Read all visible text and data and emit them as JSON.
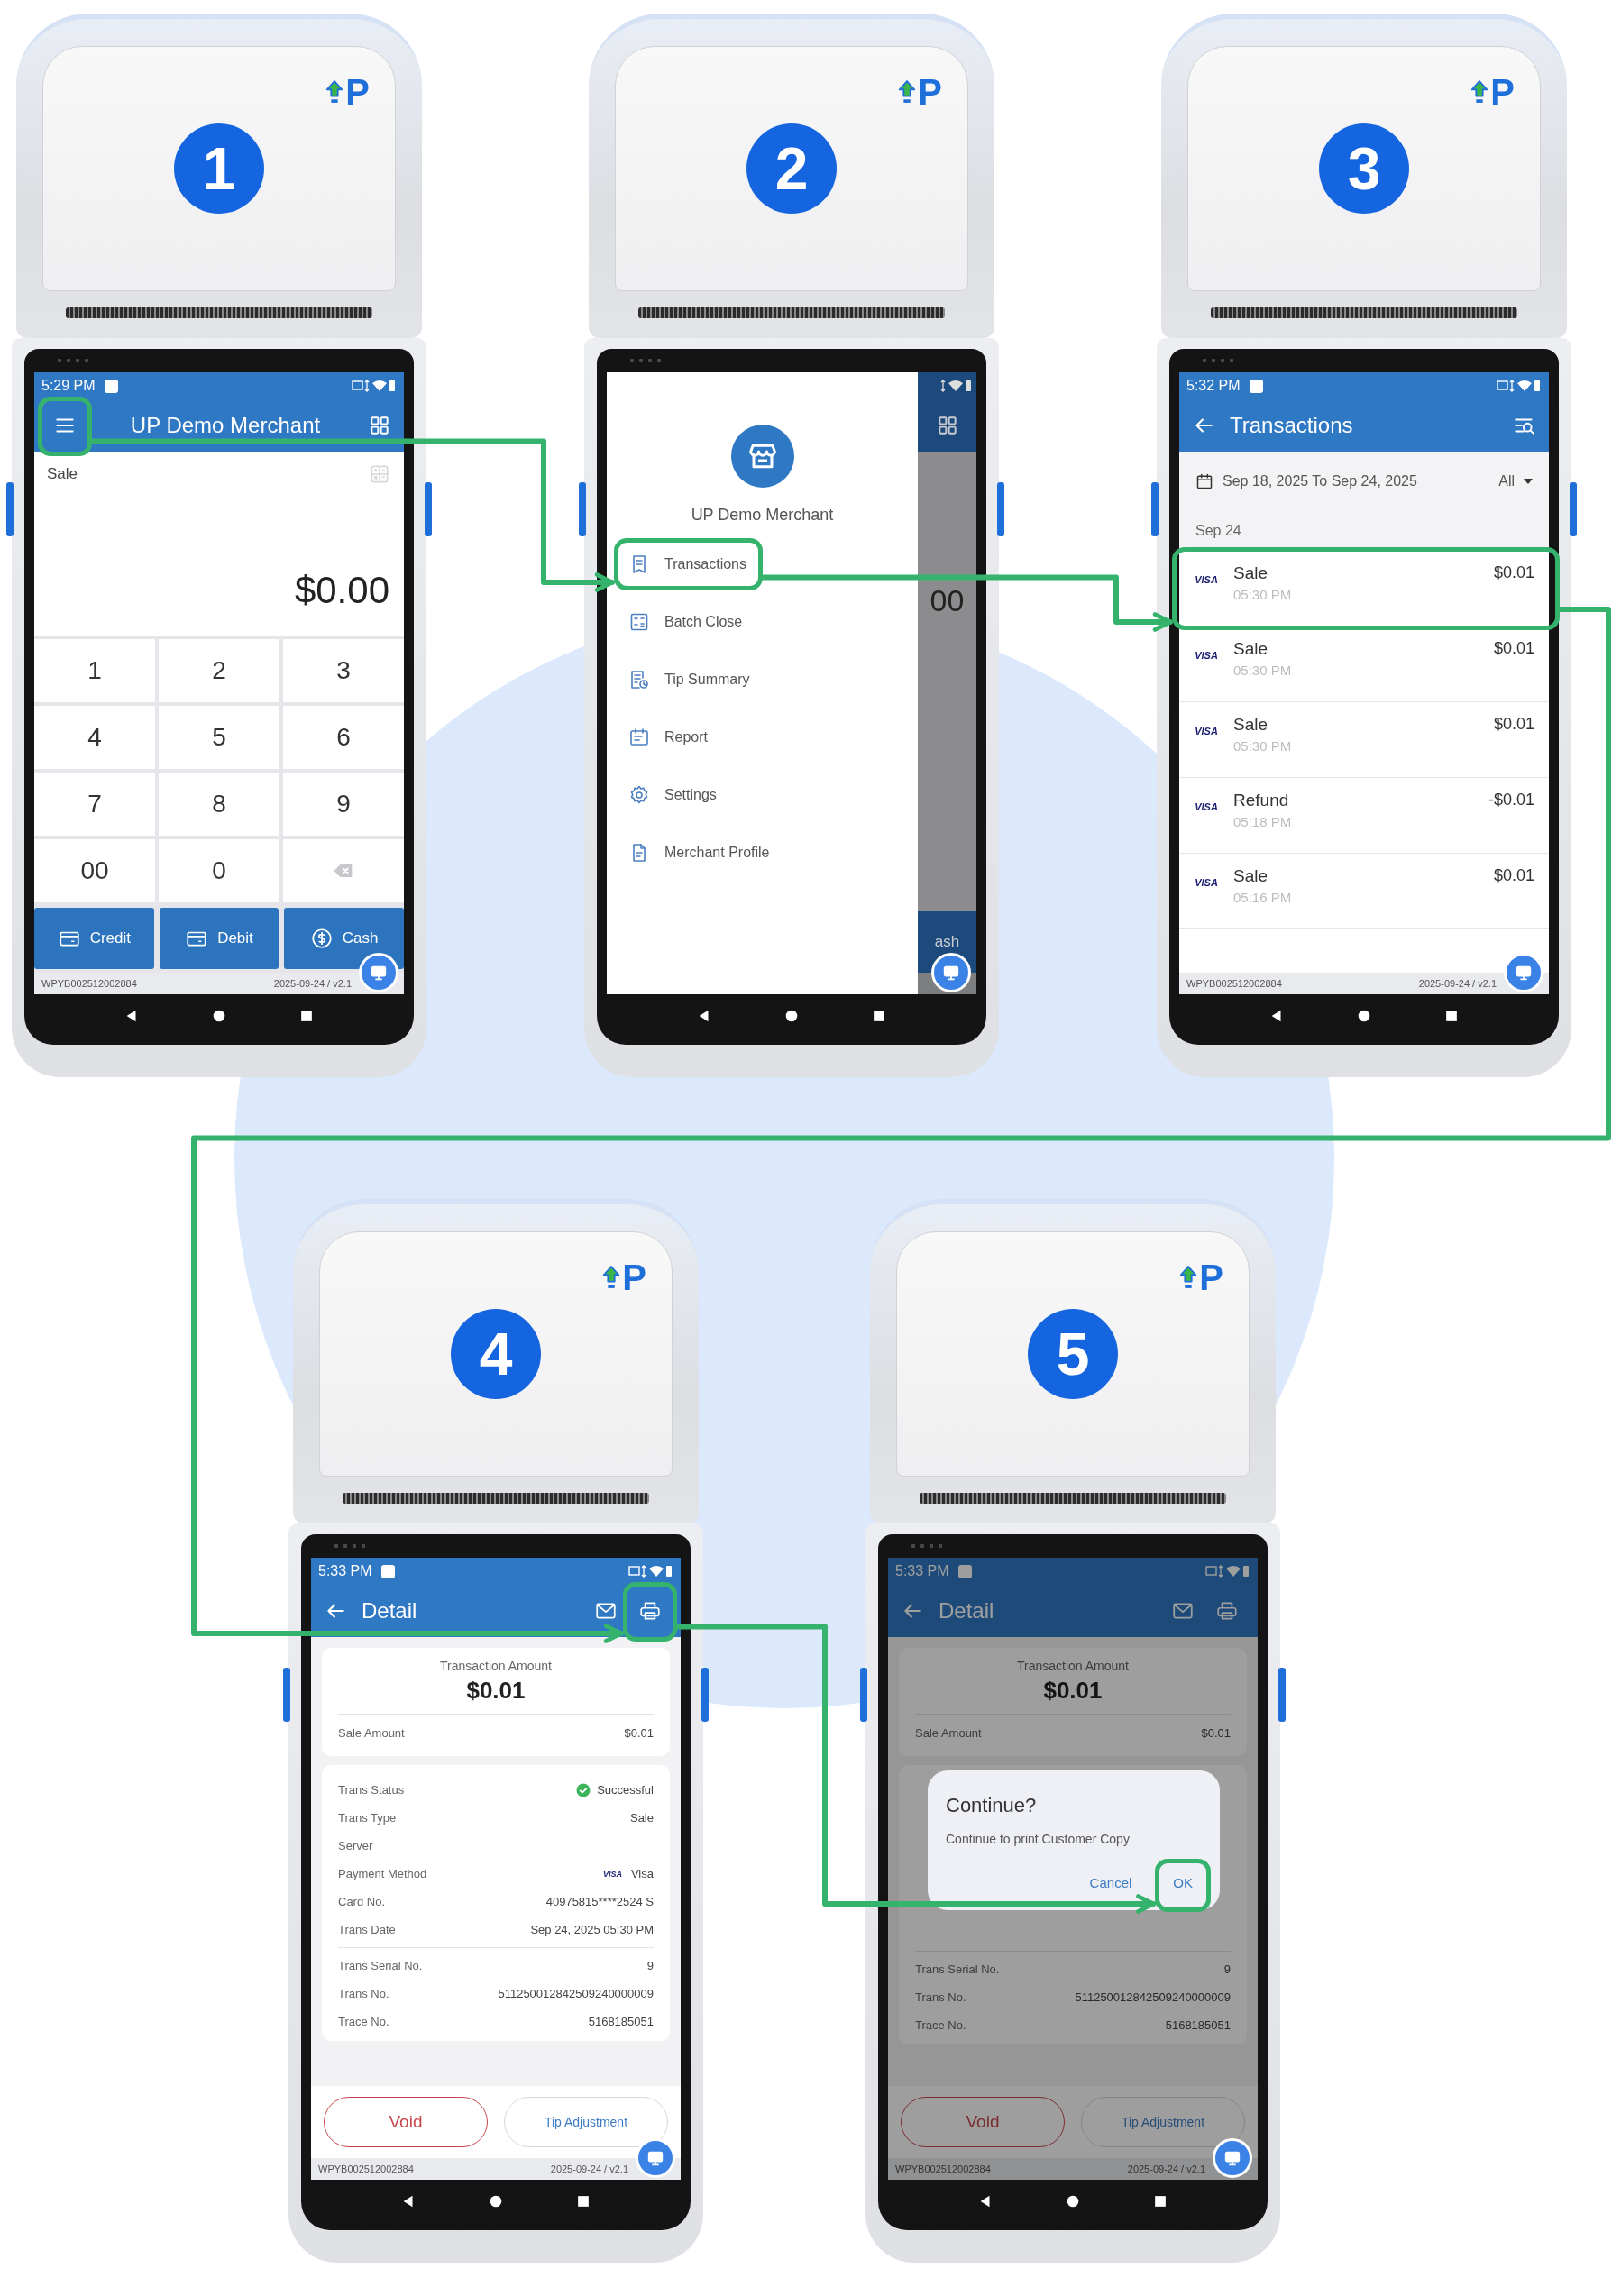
{
  "steps": [
    {
      "number": "1",
      "logo": "P",
      "screen": {
        "kind": "sale",
        "status": {
          "time": "5:29 PM"
        },
        "header": {
          "title": "UP Demo Merchant",
          "menu_highlighted": true
        },
        "mode_label": "Sale",
        "amount": "$0.00",
        "keys": [
          {
            "kind": "digit",
            "label": "1"
          },
          {
            "kind": "digit",
            "label": "2"
          },
          {
            "kind": "digit",
            "label": "3"
          },
          {
            "kind": "digit",
            "label": "4"
          },
          {
            "kind": "digit",
            "label": "5"
          },
          {
            "kind": "digit",
            "label": "6"
          },
          {
            "kind": "digit",
            "label": "7"
          },
          {
            "kind": "digit",
            "label": "8"
          },
          {
            "kind": "digit",
            "label": "9"
          },
          {
            "kind": "digit",
            "label": "00"
          },
          {
            "kind": "digit",
            "label": "0"
          },
          {
            "kind": "backspace"
          }
        ],
        "payment_buttons": [
          {
            "kind": "card",
            "label": "Credit"
          },
          {
            "kind": "card",
            "label": "Debit"
          },
          {
            "kind": "cash",
            "label": "Cash"
          }
        ],
        "footer": {
          "serial": "WPYB002512002884",
          "version": "2025-09-24 / v2.1"
        }
      }
    },
    {
      "number": "2",
      "logo": "P",
      "screen": {
        "kind": "menu",
        "merchant_name": "UP Demo Merchant",
        "menu_items": [
          {
            "kind": "transactions",
            "label": "Transactions",
            "highlighted": true
          },
          {
            "kind": "batch",
            "label": "Batch Close",
            "highlighted": false
          },
          {
            "kind": "tips",
            "label": "Tip Summary",
            "highlighted": false
          },
          {
            "kind": "report",
            "label": "Report",
            "highlighted": false
          },
          {
            "kind": "settings",
            "label": "Settings",
            "highlighted": false
          },
          {
            "kind": "profile",
            "label": "Merchant Profile",
            "highlighted": false
          }
        ],
        "background": {
          "amount_fragment": "00",
          "button_fragment": "ash"
        }
      }
    },
    {
      "number": "3",
      "logo": "P",
      "screen": {
        "kind": "transactions",
        "status": {
          "time": "5:32 PM"
        },
        "header": {
          "title": "Transactions"
        },
        "date_range": "Sep 18, 2025 To Sep 24, 2025",
        "filter": "All",
        "group_label": "Sep 24",
        "rows": [
          {
            "brand": "VISA",
            "type": "Sale",
            "time": "05:30 PM",
            "amount": "$0.01",
            "highlighted": true
          },
          {
            "brand": "VISA",
            "type": "Sale",
            "time": "05:30 PM",
            "amount": "$0.01",
            "highlighted": false
          },
          {
            "brand": "VISA",
            "type": "Sale",
            "time": "05:30 PM",
            "amount": "$0.01",
            "highlighted": false
          },
          {
            "brand": "VISA",
            "type": "Refund",
            "time": "05:18 PM",
            "amount": "-$0.01",
            "highlighted": false
          },
          {
            "brand": "VISA",
            "type": "Sale",
            "time": "05:16 PM",
            "amount": "$0.01",
            "highlighted": false
          }
        ],
        "footer": {
          "serial": "WPYB002512002884",
          "version": "2025-09-24 / v2.1"
        }
      }
    },
    {
      "number": "4",
      "logo": "P",
      "screen": {
        "kind": "detail",
        "status": {
          "time": "5:33 PM"
        },
        "header": {
          "title": "Detail",
          "print_highlighted": true
        },
        "amount_label": "Transaction Amount",
        "amount": "$0.01",
        "summary": {
          "label": "Sale Amount",
          "value": "$0.01"
        },
        "details": [
          {
            "kind": "status",
            "label": "Trans Status",
            "value": "Successful"
          },
          {
            "kind": "text",
            "label": "Trans Type",
            "value": "Sale"
          },
          {
            "kind": "text",
            "label": "Server"
          },
          {
            "kind": "brand",
            "label": "Payment Method",
            "brand": "VISA",
            "value": "Visa"
          },
          {
            "kind": "text",
            "label": "Card No.",
            "value": "40975815****2524 S"
          },
          {
            "kind": "text",
            "label": "Trans Date",
            "value": "Sep 24, 2025 05:30 PM"
          }
        ],
        "references": [
          {
            "label": "Trans Serial No.",
            "value": "9"
          },
          {
            "label": "Trans No.",
            "value": "511250012842509240000009"
          },
          {
            "label": "Trace No.",
            "value": "5168185051"
          }
        ],
        "actions": [
          {
            "kind": "void",
            "label": "Void"
          },
          {
            "kind": "secondary",
            "label": "Tip Adjustment"
          }
        ],
        "footer": {
          "serial": "WPYB002512002884",
          "version": "2025-09-24 / v2.1"
        }
      }
    },
    {
      "number": "5",
      "logo": "P",
      "screen": {
        "kind": "detail",
        "status": {
          "time": "5:33 PM"
        },
        "header": {
          "title": "Detail",
          "print_highlighted": false
        },
        "amount_label": "Transaction Amount",
        "amount": "$0.01",
        "summary": {
          "label": "Sale Amount",
          "value": "$0.01"
        },
        "references": [
          {
            "label": "Trans Serial No.",
            "value": "9"
          },
          {
            "label": "Trans No.",
            "value": "511250012842509240000009"
          },
          {
            "label": "Trace No.",
            "value": "5168185051"
          }
        ],
        "actions": [
          {
            "kind": "void",
            "label": "Void"
          },
          {
            "kind": "secondary",
            "label": "Tip Adjustment"
          }
        ],
        "dialog": {
          "title": "Continue?",
          "message": "Continue to print Customer Copy",
          "buttons": [
            {
              "label": "Cancel",
              "highlighted": false
            },
            {
              "label": "OK",
              "highlighted": true
            }
          ]
        },
        "footer": {
          "serial": "WPYB002512002884",
          "version": "2025-09-24 / v2.1"
        }
      }
    }
  ]
}
